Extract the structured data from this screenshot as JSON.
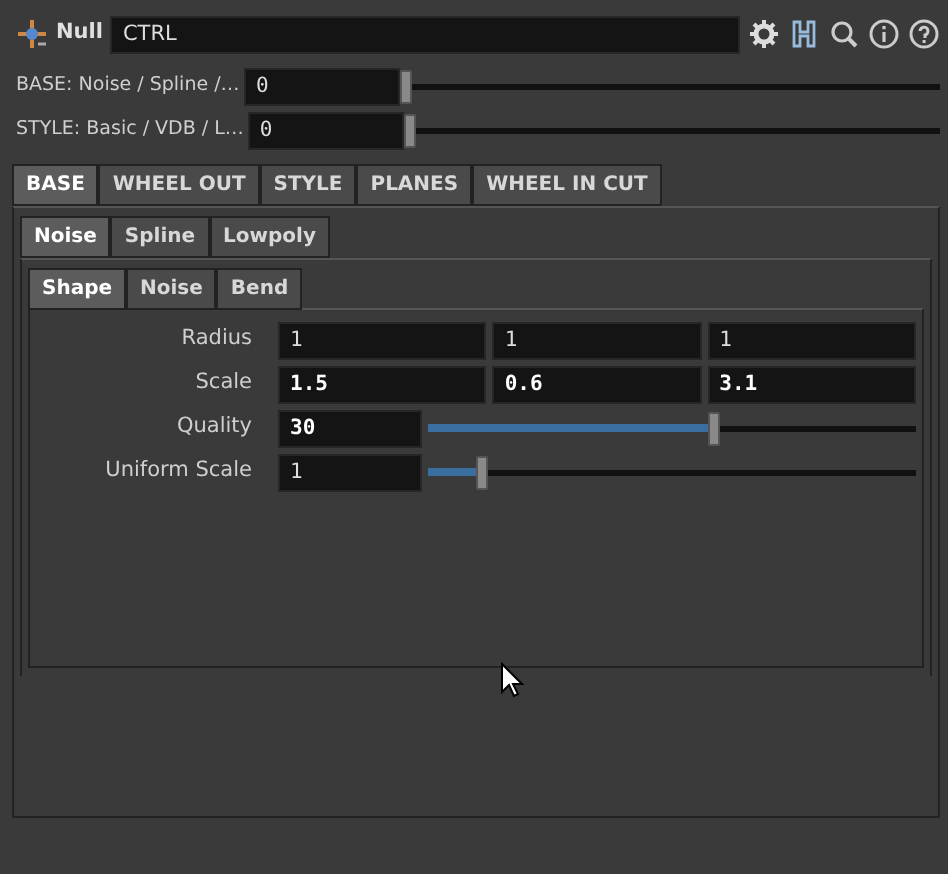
{
  "node": {
    "type": "Null",
    "name": "CTRL"
  },
  "top_params": [
    {
      "label": "BASE: Noise / Spline /…",
      "value": "0",
      "level": 0
    },
    {
      "label": "STYLE: Basic / VDB / L…",
      "value": "0",
      "level": 0
    }
  ],
  "tabs": [
    {
      "label": "BASE",
      "selected": true
    },
    {
      "label": "WHEEL OUT",
      "selected": false
    },
    {
      "label": "STYLE",
      "selected": false
    },
    {
      "label": "PLANES",
      "selected": false
    },
    {
      "label": "WHEEL IN CUT",
      "selected": false
    }
  ],
  "subtabs": [
    {
      "label": "Noise",
      "selected": true
    },
    {
      "label": "Spline",
      "selected": false
    },
    {
      "label": "Lowpoly",
      "selected": false
    }
  ],
  "subsubtabs": [
    {
      "label": "Shape",
      "selected": true
    },
    {
      "label": "Noise",
      "selected": false
    },
    {
      "label": "Bend",
      "selected": false
    }
  ],
  "params": [
    {
      "kind": "vector",
      "label": "Radius",
      "values": [
        "1",
        "1",
        "1"
      ],
      "modified": false
    },
    {
      "kind": "vector",
      "label": "Scale",
      "values": [
        "1.5",
        "0.6",
        "3.1"
      ],
      "modified": true
    },
    {
      "kind": "slider",
      "label": "Quality",
      "value": "30",
      "modified": true,
      "level": 0.59
    },
    {
      "kind": "slider",
      "label": "Uniform Scale",
      "value": "1",
      "modified": false,
      "level": 0.1
    }
  ]
}
